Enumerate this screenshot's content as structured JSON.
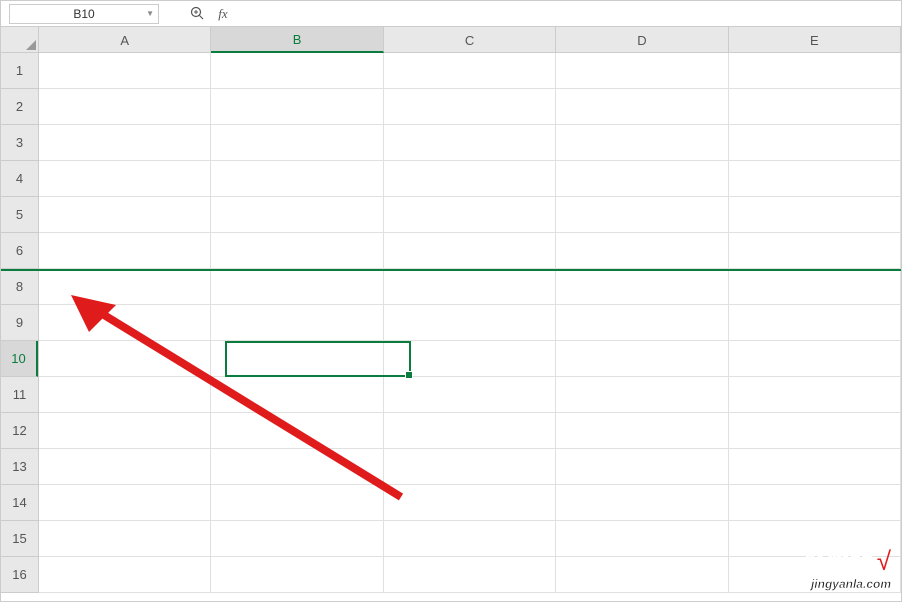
{
  "formula_bar": {
    "name_box_value": "B10",
    "formula_value": ""
  },
  "columns": [
    "A",
    "B",
    "C",
    "D",
    "E"
  ],
  "active_column": "B",
  "rows": [
    1,
    2,
    3,
    4,
    5,
    6,
    8,
    9,
    10,
    11,
    12,
    13,
    14,
    15,
    16
  ],
  "hidden_rows": [
    7
  ],
  "active_row": 10,
  "selected_cell": "B10",
  "watermark": {
    "main": "经验啦",
    "check": "√",
    "sub": "jingyanla.com"
  },
  "icons": {
    "zoom": "zoom-icon",
    "fx": "fx"
  }
}
